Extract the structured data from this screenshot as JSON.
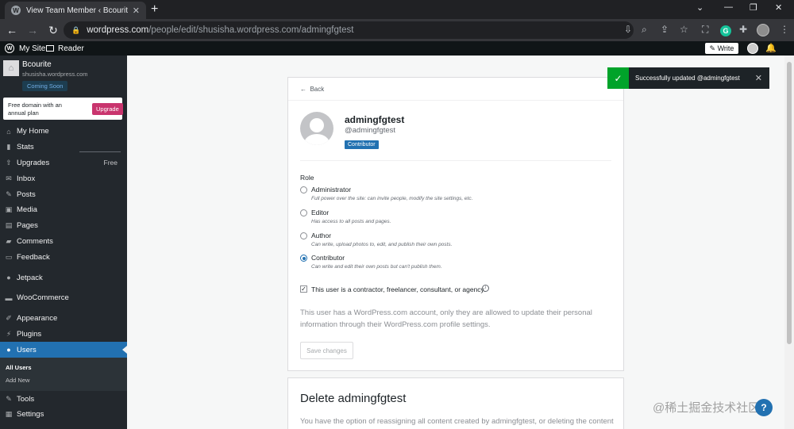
{
  "browser": {
    "tab_title": "View Team Member ‹ Bcourite — ",
    "url_host": "wordpress.com",
    "url_path": "/people/edit/shusisha.wordpress.com/admingfgtest"
  },
  "adminbar": {
    "my_site": "My Site",
    "reader": "Reader",
    "write": "Write"
  },
  "site": {
    "name": "Bcourite",
    "url": "shusisha.wordpress.com",
    "status": "Coming Soon"
  },
  "upsell": {
    "text": "Free domain with an annual plan",
    "button": "Upgrade"
  },
  "menu": {
    "my_home": "My Home",
    "stats": "Stats",
    "upgrades": "Upgrades",
    "upgrades_extra": "Free",
    "inbox": "Inbox",
    "posts": "Posts",
    "media": "Media",
    "pages": "Pages",
    "comments": "Comments",
    "feedback": "Feedback",
    "jetpack": "Jetpack",
    "woocommerce": "WooCommerce",
    "appearance": "Appearance",
    "plugins": "Plugins",
    "users": "Users",
    "all_users": "All Users",
    "add_new": "Add New",
    "tools": "Tools",
    "settings": "Settings"
  },
  "member": {
    "back": "Back",
    "display_name": "admingfgtest",
    "login": "@admingfgtest",
    "badge": "Contributor"
  },
  "role": {
    "label": "Role",
    "selected": "Contributor",
    "options": [
      {
        "name": "Administrator",
        "desc": "Full power over the site: can invite people, modify the site settings, etc."
      },
      {
        "name": "Editor",
        "desc": "Has access to all posts and pages."
      },
      {
        "name": "Author",
        "desc": "Can write, upload photos to, edit, and publish their own posts."
      },
      {
        "name": "Contributor",
        "desc": "Can write and edit their own posts but can't publish them."
      }
    ]
  },
  "contractor": {
    "label": "This user is a contractor, freelancer, consultant, or agency.",
    "checked": true
  },
  "notice": "This user has a WordPress.com account, only they are allowed to update their personal information through their WordPress.com profile settings.",
  "save_button": "Save changes",
  "delete_section": {
    "title": "Delete admingfgtest",
    "text": "You have the option of reassigning all content created by admingfgtest, or deleting the content"
  },
  "toast": {
    "message": "Successfully updated @admingfgtest"
  },
  "watermark": "@稀土掘金技术社区",
  "colors": {
    "accent": "#2271b1",
    "sidebar": "#23282d",
    "success": "#00a32a",
    "upgrade": "#c9356e"
  }
}
